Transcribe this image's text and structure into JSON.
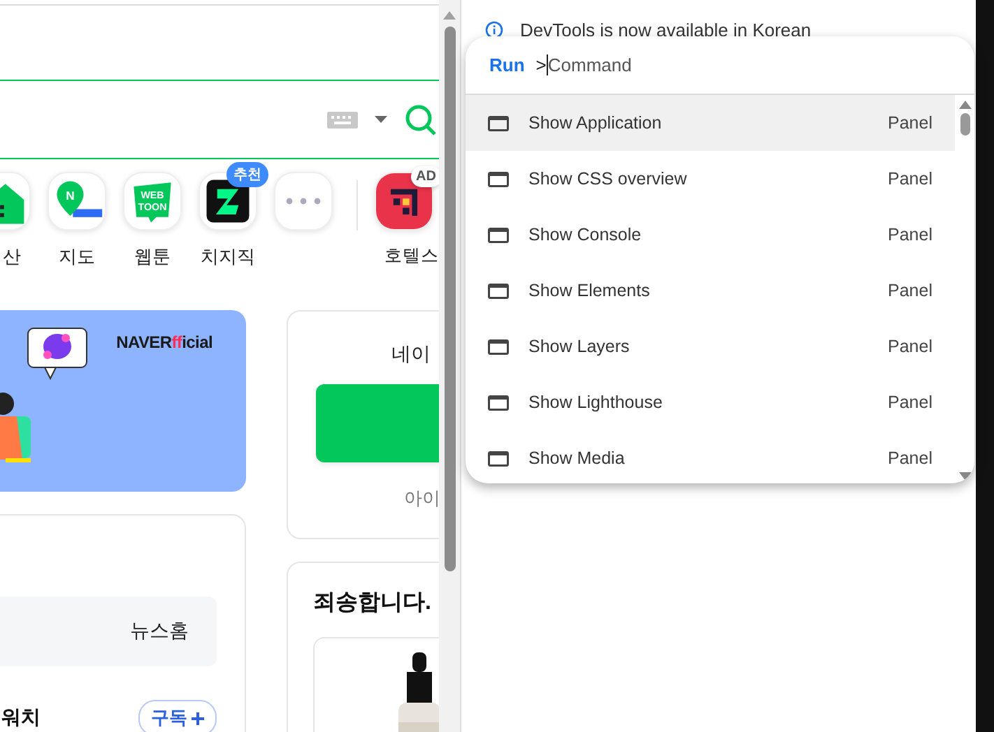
{
  "page": {
    "shortcuts": [
      {
        "kind": "house",
        "label": "산"
      },
      {
        "kind": "map",
        "label": "지도",
        "logo": "N"
      },
      {
        "kind": "webtoon",
        "label": "웹툰",
        "logo_lines": [
          "WEB",
          "TOON"
        ]
      },
      {
        "kind": "chzzk",
        "label": "치지직",
        "badge": "추천"
      },
      {
        "kind": "more"
      },
      {
        "kind": "ad",
        "label": "호텔스",
        "badge": "AD"
      }
    ],
    "banner": {
      "brand": [
        {
          "text": "NAVER",
          "color": "#1a1a1a"
        },
        {
          "text": "ff",
          "color": "#ff2d55"
        },
        {
          "text": "icial",
          "color": "#1a1a1a"
        }
      ]
    },
    "news": {
      "tab": "뉴스홈",
      "press": "워치",
      "subscribe": "구독"
    },
    "login": {
      "title": "네이",
      "hint": "아이"
    },
    "shopping": {
      "title": "죄송합니다."
    }
  },
  "devtools": {
    "notice": "DevTools is now available in Korean",
    "palette": {
      "prompt": "Run",
      "prefix": ">",
      "placeholder": "Command",
      "items": [
        {
          "label": "Show Application",
          "category": "Panel",
          "selected": true
        },
        {
          "label": "Show CSS overview",
          "category": "Panel",
          "selected": false
        },
        {
          "label": "Show Console",
          "category": "Panel",
          "selected": false
        },
        {
          "label": "Show Elements",
          "category": "Panel",
          "selected": false
        },
        {
          "label": "Show Layers",
          "category": "Panel",
          "selected": false
        },
        {
          "label": "Show Lighthouse",
          "category": "Panel",
          "selected": false
        },
        {
          "label": "Show Media",
          "category": "Panel",
          "selected": false
        }
      ]
    }
  }
}
